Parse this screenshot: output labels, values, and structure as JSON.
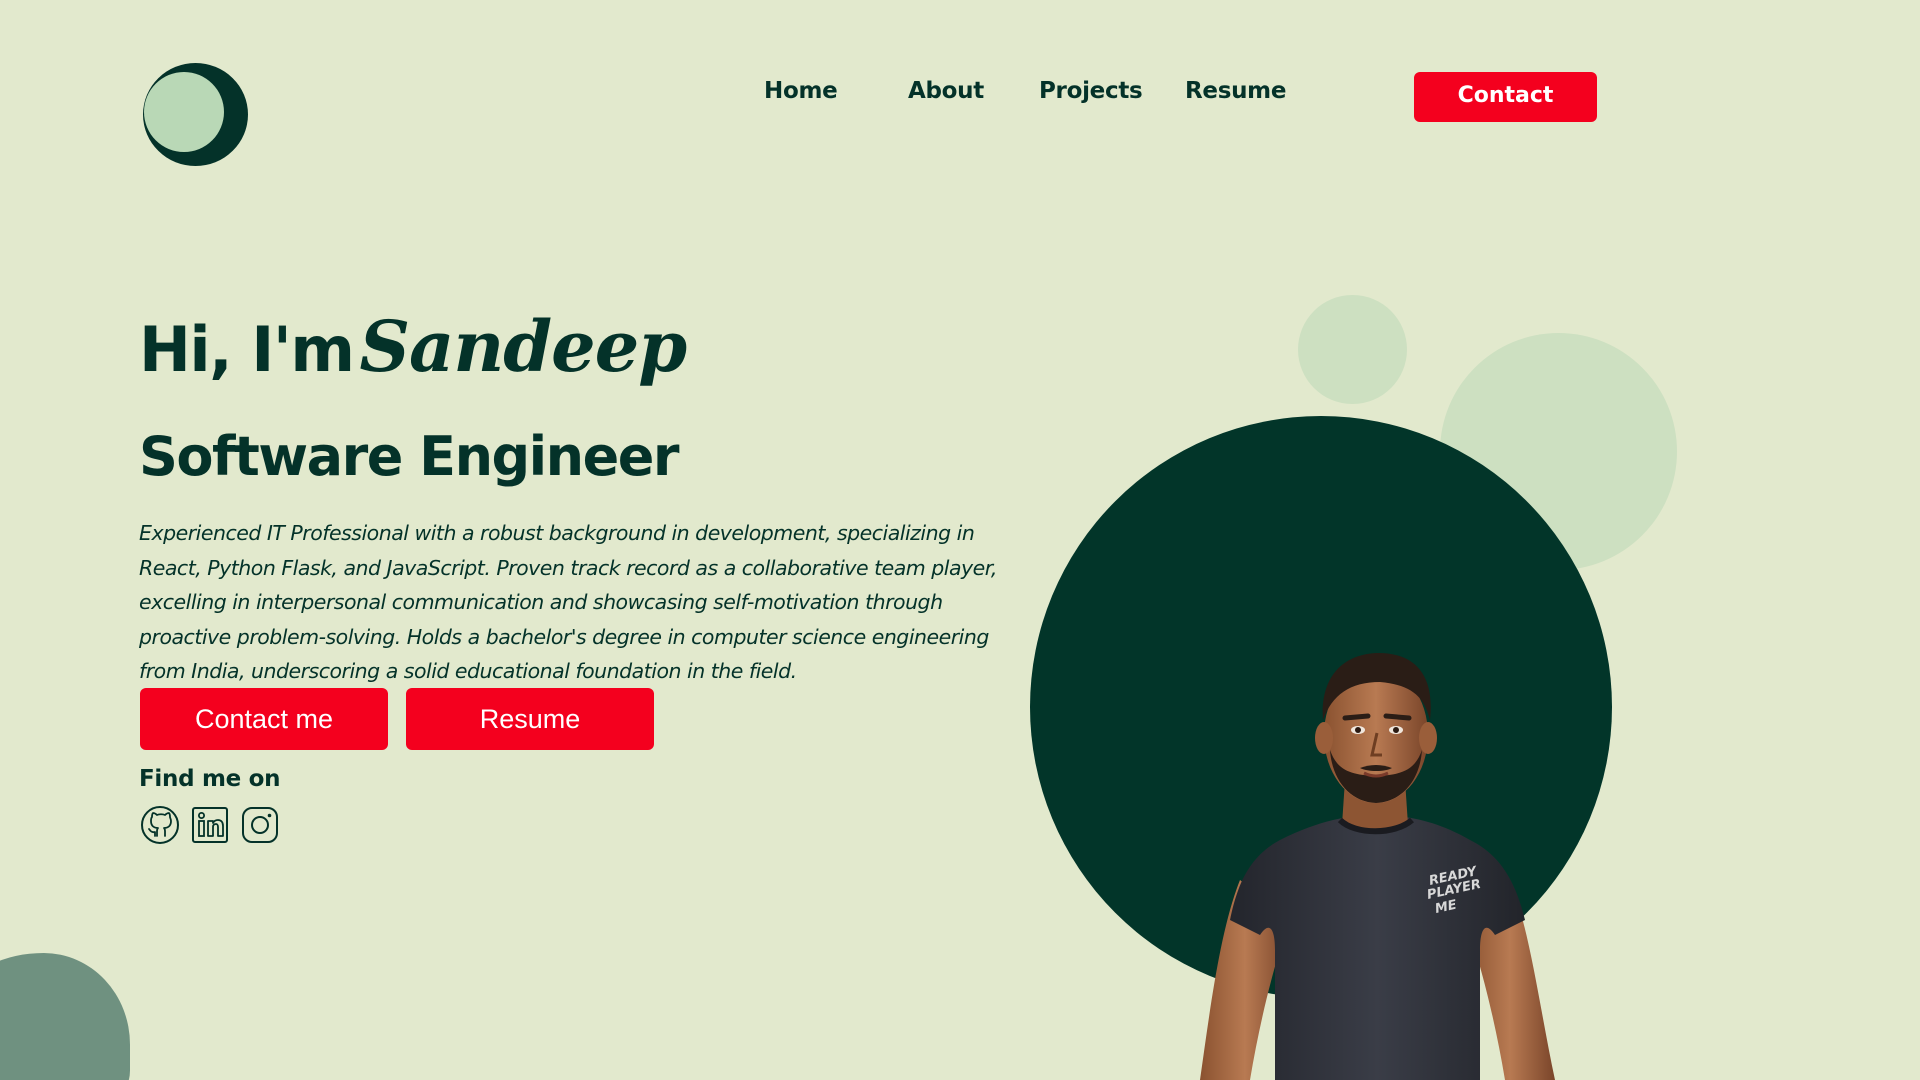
{
  "header": {
    "logo_name": "moon-logo",
    "nav": {
      "home": "Home",
      "about": "About",
      "projects": "Projects",
      "resume": "Resume"
    },
    "contact_label": "Contact"
  },
  "hero": {
    "greeting": "Hi, I'm",
    "name": "Sandeep",
    "role": "Software Engineer",
    "bio": "Experienced IT Professional with a robust background in development, specializing in React, Python Flask, and JavaScript. Proven track record as a collaborative team player, excelling in interpersonal communication and showcasing self-motivation through proactive problem-solving. Holds a bachelor's degree in computer science engineering from India, underscoring a solid educational foundation in the field.",
    "contact_button": "Contact me",
    "resume_button": "Resume",
    "find_me_label": "Find me on",
    "social_icons": [
      "github-icon",
      "linkedin-icon",
      "instagram-icon"
    ]
  },
  "avatar": {
    "shirt_text": "READY\nPLAYER\nME"
  },
  "colors": {
    "background": "#e2e9cd",
    "primary_dark": "#043229",
    "accent_red": "#f4001e",
    "light_circle": "#cde0c1",
    "blob": "#6f9180"
  }
}
